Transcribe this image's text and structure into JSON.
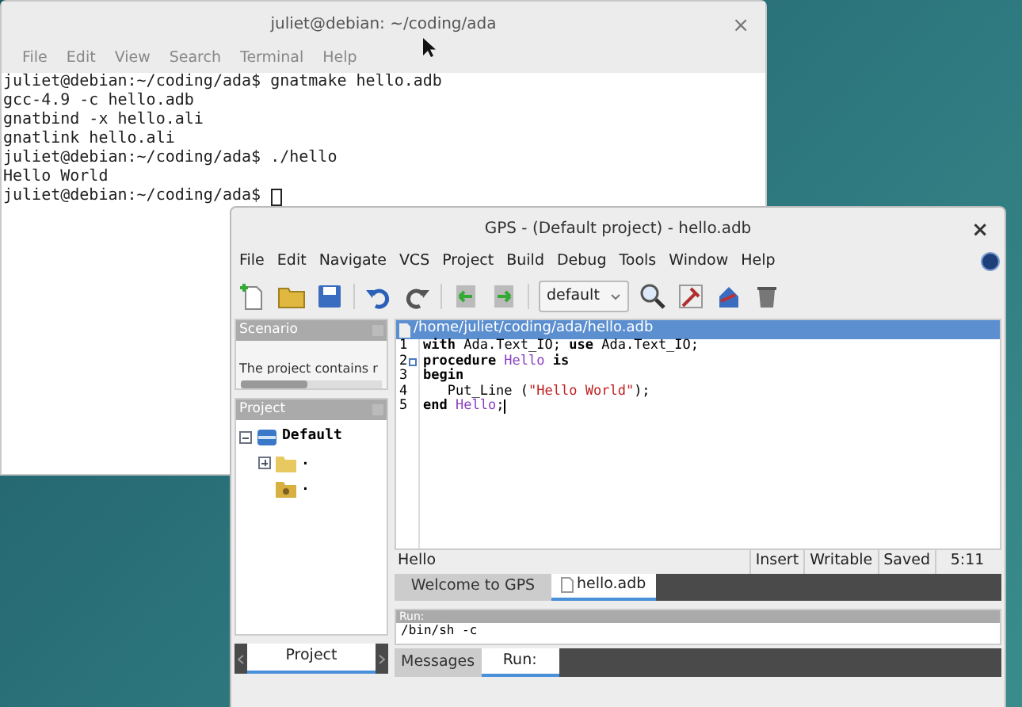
{
  "terminal": {
    "title": "juliet@debian: ~/coding/ada",
    "close": "×",
    "menu": [
      "File",
      "Edit",
      "View",
      "Search",
      "Terminal",
      "Help"
    ],
    "lines": [
      "juliet@debian:~/coding/ada$ gnatmake hello.adb",
      "gcc-4.9 -c hello.adb",
      "gnatbind -x hello.ali",
      "gnatlink hello.ali",
      "juliet@debian:~/coding/ada$ ./hello",
      "Hello World",
      "juliet@debian:~/coding/ada$ "
    ]
  },
  "gps": {
    "title": "GPS - (Default project) - hello.adb",
    "close": "×",
    "menu": [
      "File",
      "Edit",
      "Navigate",
      "VCS",
      "Project",
      "Build",
      "Debug",
      "Tools",
      "Window",
      "Help"
    ],
    "scenario_combo": "default",
    "scenario": {
      "title": "Scenario",
      "text": "The project contains r"
    },
    "project": {
      "title": "Project",
      "tree": [
        {
          "label": "Default",
          "kind": "project",
          "expanded": true,
          "children": [
            {
              "label": ".",
              "kind": "folder",
              "expanded": false
            },
            {
              "label": ".",
              "kind": "object-folder"
            }
          ]
        }
      ]
    },
    "left_tabs": [
      {
        "label": "Project",
        "selected": true
      }
    ],
    "editor": {
      "path": "/home/juliet/coding/ada/hello.adb",
      "lines": [
        {
          "number": "1",
          "tokens": [
            {
              "t": "with",
              "kind": "keyword"
            },
            {
              "t": " Ada.Text_IO; ",
              "kind": "plain"
            },
            {
              "t": "use",
              "kind": "keyword"
            },
            {
              "t": " Ada.Text_IO;",
              "kind": "plain"
            }
          ]
        },
        {
          "number": "2",
          "fold": true,
          "tokens": [
            {
              "t": "procedure",
              "kind": "keyword"
            },
            {
              "t": " Hello",
              "kind": "name"
            },
            {
              "t": " is",
              "kind": "keyword"
            }
          ]
        },
        {
          "number": "3",
          "tokens": [
            {
              "t": "begin",
              "kind": "keyword"
            }
          ]
        },
        {
          "number": "4",
          "tokens": [
            {
              "t": "   Put_Line (",
              "kind": "plain"
            },
            {
              "t": "\"Hello World\"",
              "kind": "string"
            },
            {
              "t": ");",
              "kind": "plain"
            }
          ]
        },
        {
          "number": "5",
          "tokens": [
            {
              "t": "end",
              "kind": "keyword"
            },
            {
              "t": " Hello",
              "kind": "name"
            },
            {
              "t": ";",
              "kind": "plain"
            }
          ]
        }
      ],
      "status_left": "Hello",
      "status": [
        "Insert",
        "Writable",
        "Saved",
        "5:11"
      ]
    },
    "editor_tabs": [
      {
        "label": "Welcome to GPS",
        "selected": false,
        "kind": "plain"
      },
      {
        "label": "hello.adb",
        "selected": true,
        "kind": "file"
      }
    ],
    "run": {
      "title": "Run:",
      "lines": [
        "/bin/sh -c"
      ]
    },
    "bottom_tabs": [
      {
        "label": "Messages",
        "selected": false
      },
      {
        "label": "Run:",
        "selected": true
      }
    ]
  }
}
